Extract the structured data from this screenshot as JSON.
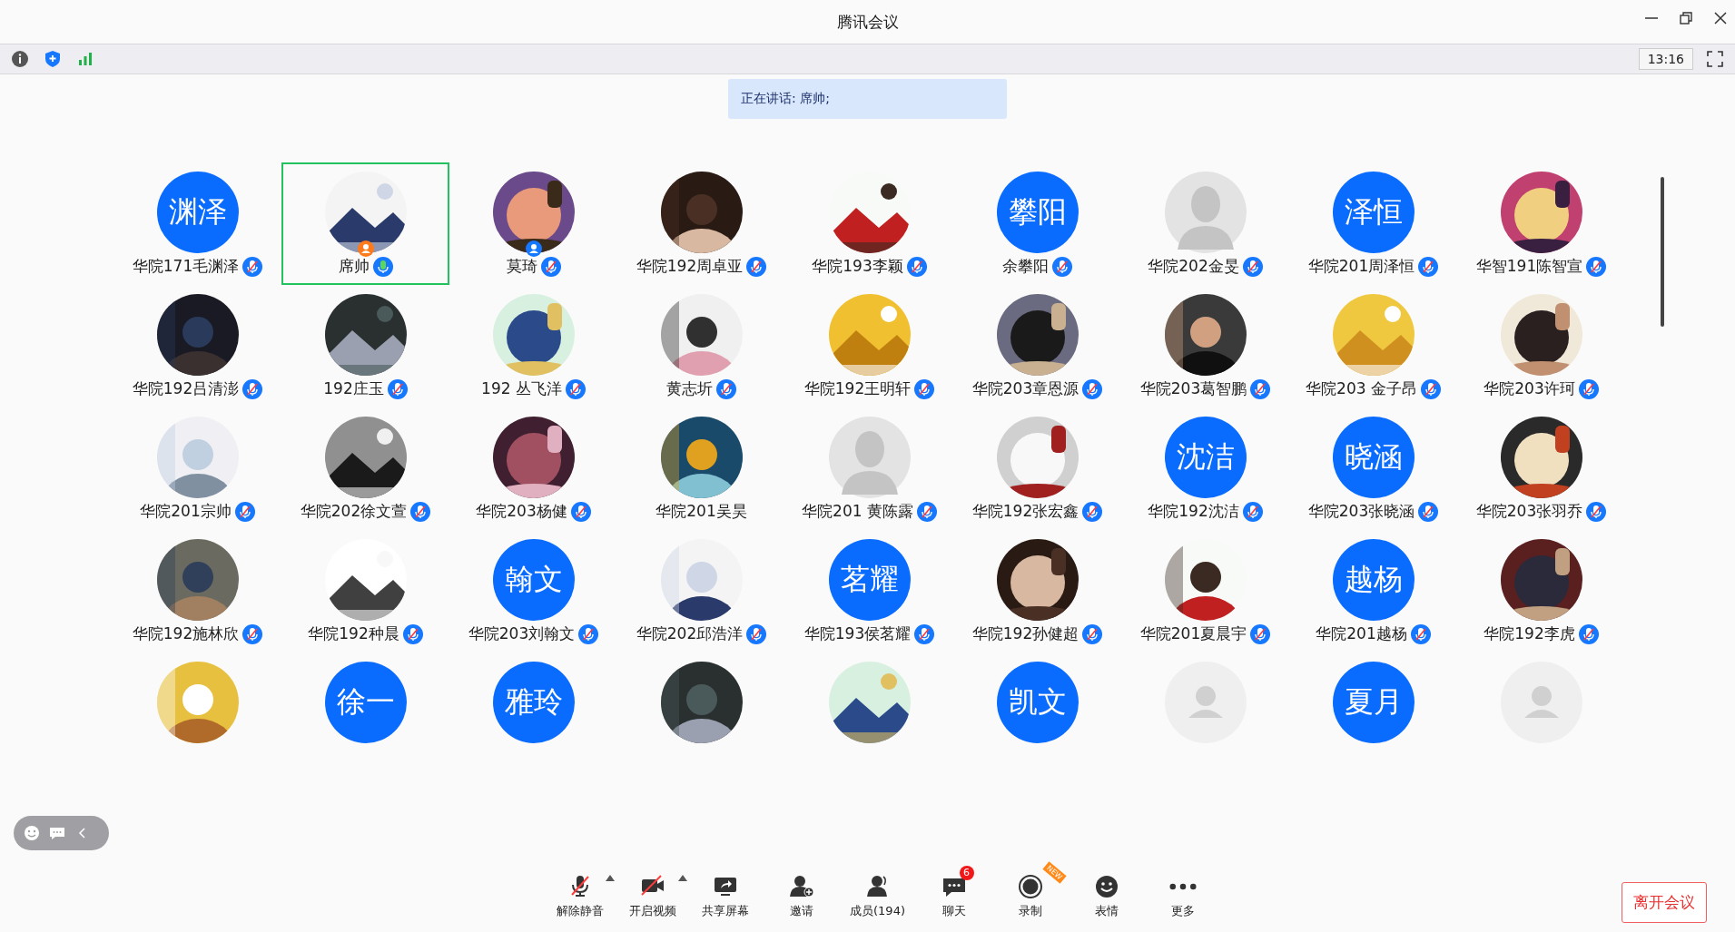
{
  "window": {
    "title": "腾讯会议"
  },
  "status_bar": {
    "time": "13:16"
  },
  "speaking_banner": {
    "text": "正在讲话: 席帅;"
  },
  "participants": [
    {
      "kind": "initials",
      "initials": "渊泽",
      "name": "华院171毛渊泽",
      "muted": true,
      "speaking": false,
      "highlighted": false
    },
    {
      "kind": "picture",
      "name": "席帅",
      "muted": false,
      "speaking": true,
      "host": true,
      "highlighted": true
    },
    {
      "kind": "picture",
      "name": "莫琦",
      "muted": true,
      "speaking": false,
      "cohost": true,
      "highlighted": false
    },
    {
      "kind": "picture",
      "name": "华院192周卓亚",
      "muted": true,
      "speaking": false,
      "highlighted": false
    },
    {
      "kind": "picture",
      "name": "华院193李颖",
      "muted": true,
      "speaking": false,
      "highlighted": false
    },
    {
      "kind": "initials",
      "initials": "攀阳",
      "name": "余攀阳",
      "muted": true,
      "speaking": false,
      "highlighted": false
    },
    {
      "kind": "default",
      "name": "华院202金旻",
      "muted": true,
      "speaking": false,
      "highlighted": false
    },
    {
      "kind": "initials",
      "initials": "泽恒",
      "name": "华院201周泽恒",
      "muted": true,
      "speaking": false,
      "highlighted": false
    },
    {
      "kind": "picture",
      "name": "华智191陈智宣",
      "muted": true,
      "speaking": false,
      "highlighted": false
    },
    {
      "kind": "picture",
      "name": "华院192吕清澎",
      "muted": true,
      "speaking": false,
      "highlighted": false
    },
    {
      "kind": "picture",
      "name": "192庄玉",
      "muted": true,
      "speaking": false,
      "highlighted": false
    },
    {
      "kind": "picture",
      "name": "192 丛飞洋",
      "muted": true,
      "speaking": false,
      "highlighted": false
    },
    {
      "kind": "picture",
      "name": "黄志圻",
      "muted": true,
      "speaking": false,
      "highlighted": false
    },
    {
      "kind": "picture",
      "name": "华院192王明轩",
      "muted": true,
      "speaking": false,
      "highlighted": false
    },
    {
      "kind": "picture",
      "name": "华院203章恩源",
      "muted": true,
      "speaking": false,
      "highlighted": false
    },
    {
      "kind": "picture",
      "name": "华院203葛智鹏",
      "muted": true,
      "speaking": false,
      "highlighted": false
    },
    {
      "kind": "picture",
      "name": "华院203 金子昂",
      "muted": true,
      "speaking": false,
      "highlighted": false
    },
    {
      "kind": "picture",
      "name": "华院203许珂",
      "muted": true,
      "speaking": false,
      "highlighted": false
    },
    {
      "kind": "picture",
      "name": "华院201宗帅",
      "muted": true,
      "speaking": false,
      "highlighted": false
    },
    {
      "kind": "picture",
      "name": "华院202徐文萱",
      "muted": true,
      "speaking": false,
      "highlighted": false
    },
    {
      "kind": "picture",
      "name": "华院203杨健",
      "muted": true,
      "speaking": false,
      "highlighted": false
    },
    {
      "kind": "picture",
      "name": "华院201吴昊",
      "muted": false,
      "speaking": false,
      "highlighted": false
    },
    {
      "kind": "default",
      "name": "华院201 黄陈露",
      "muted": true,
      "speaking": false,
      "highlighted": false
    },
    {
      "kind": "picture",
      "name": "华院192张宏鑫",
      "muted": true,
      "speaking": false,
      "highlighted": false
    },
    {
      "kind": "initials",
      "initials": "沈洁",
      "name": "华院192沈洁",
      "muted": true,
      "speaking": false,
      "highlighted": false
    },
    {
      "kind": "initials",
      "initials": "晓涵",
      "name": "华院203张晓涵",
      "muted": true,
      "speaking": false,
      "highlighted": false
    },
    {
      "kind": "picture",
      "name": "华院203张羽乔",
      "muted": true,
      "speaking": false,
      "highlighted": false
    },
    {
      "kind": "picture",
      "name": "华院192施林欣",
      "muted": true,
      "speaking": false,
      "highlighted": false
    },
    {
      "kind": "picture",
      "name": "华院192种晨",
      "muted": true,
      "speaking": false,
      "highlighted": false
    },
    {
      "kind": "initials",
      "initials": "翰文",
      "name": "华院203刘翰文",
      "muted": true,
      "speaking": false,
      "highlighted": false
    },
    {
      "kind": "picture",
      "name": "华院202邱浩洋",
      "muted": true,
      "speaking": false,
      "highlighted": false
    },
    {
      "kind": "initials",
      "initials": "茗耀",
      "name": "华院193侯茗耀",
      "muted": true,
      "speaking": false,
      "highlighted": false
    },
    {
      "kind": "picture",
      "name": "华院192孙健超",
      "muted": true,
      "speaking": false,
      "highlighted": false
    },
    {
      "kind": "picture",
      "name": "华院201夏晨宇",
      "muted": true,
      "speaking": false,
      "highlighted": false
    },
    {
      "kind": "initials",
      "initials": "越杨",
      "name": "华院201越杨",
      "muted": true,
      "speaking": false,
      "highlighted": false
    },
    {
      "kind": "picture",
      "name": "华院192李虎",
      "muted": true,
      "speaking": false,
      "highlighted": false
    },
    {
      "kind": "picture",
      "highlighted": false
    },
    {
      "kind": "initials",
      "initials": "徐一",
      "highlighted": false
    },
    {
      "kind": "initials",
      "initials": "雅玲",
      "highlighted": false
    },
    {
      "kind": "picture",
      "highlighted": false
    },
    {
      "kind": "picture",
      "highlighted": false
    },
    {
      "kind": "initials",
      "initials": "凯文",
      "highlighted": false
    },
    {
      "kind": "default",
      "highlighted": false
    },
    {
      "kind": "initials",
      "initials": "夏月",
      "highlighted": false
    },
    {
      "kind": "default",
      "highlighted": false
    }
  ],
  "toolbar": [
    {
      "label": "解除静音",
      "has_menu": true
    },
    {
      "label": "开启视频",
      "has_menu": true
    },
    {
      "label": "共享屏幕",
      "has_menu": false
    },
    {
      "label": "邀请",
      "has_menu": false
    },
    {
      "label": "成员(194)",
      "has_menu": false
    },
    {
      "label": "聊天",
      "has_menu": false,
      "badge": "6"
    },
    {
      "label": "录制",
      "has_menu": false,
      "ribbon": "NEW"
    },
    {
      "label": "表情",
      "has_menu": false
    },
    {
      "label": "更多",
      "has_menu": false
    }
  ],
  "leave_button": {
    "label": "离开会议"
  }
}
